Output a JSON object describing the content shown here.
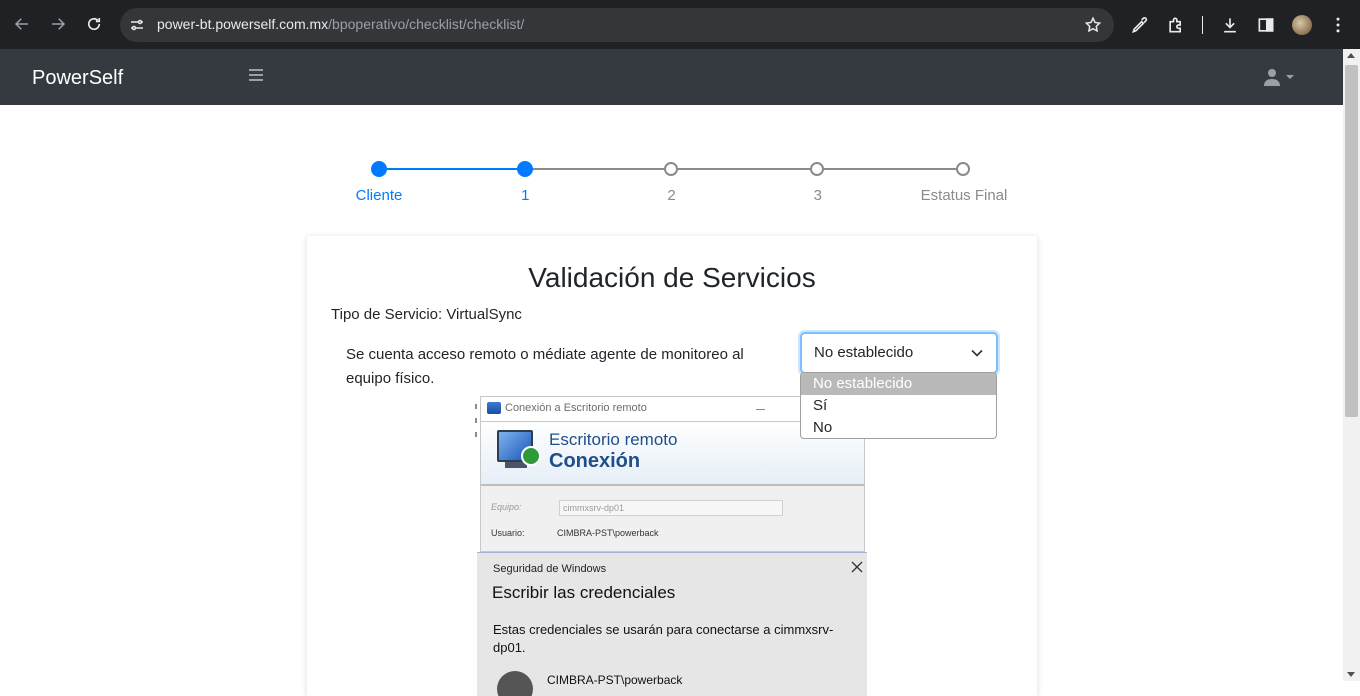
{
  "browser": {
    "url_host": "power-bt.powerself.com.mx",
    "url_path": "/bpoperativo/checklist/checklist/"
  },
  "navbar": {
    "brand": "PowerSelf"
  },
  "stepper": {
    "steps": [
      {
        "label": "Cliente",
        "state": "done"
      },
      {
        "label": "1",
        "state": "done"
      },
      {
        "label": "2",
        "state": "todo"
      },
      {
        "label": "3",
        "state": "todo"
      },
      {
        "label": "Estatus Final",
        "state": "todo"
      }
    ],
    "completed_count": 2,
    "colors": {
      "done": "#007bff",
      "todo": "#8a8a8a"
    }
  },
  "card": {
    "title": "Validación de Servicios",
    "service_type": "Tipo de Servicio: VirtualSync",
    "question": "Se cuenta acceso remoto o médiate agente de monitoreo al equipo físico.",
    "select": {
      "value": "No establecido",
      "options": [
        "No establecido",
        "Sí",
        "No"
      ],
      "selected_index": 0
    }
  },
  "screenshot": {
    "window_title": "Conexión a Escritorio remoto",
    "banner_line1": "Escritorio remoto",
    "banner_line2": "Conexión",
    "equipo_label": "Equipo:",
    "equipo_value": "cimmxsrv-dp01",
    "usuario_label": "Usuario:",
    "usuario_value": "CIMBRA-PST\\powerback",
    "security_header": "Seguridad de Windows",
    "security_title": "Escribir las credenciales",
    "security_text": "Estas credenciales se usarán para conectarse a cimmxsrv-dp01.",
    "security_user": "CIMBRA-PST\\powerback"
  }
}
